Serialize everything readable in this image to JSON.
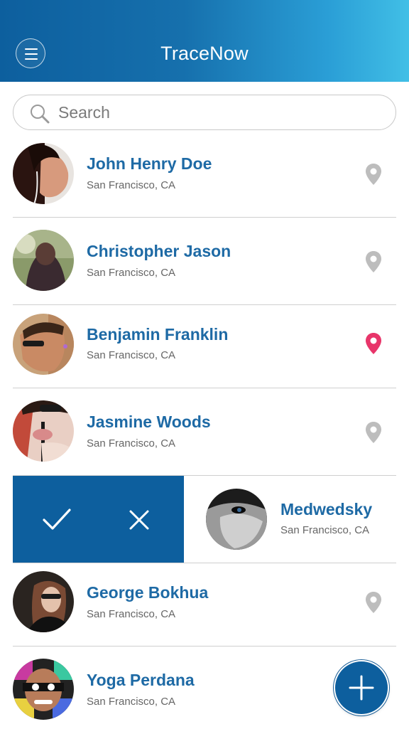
{
  "header": {
    "title": "TraceNow",
    "menu_icon": "hamburger-icon",
    "gradient_colors": [
      "#0d5f9e",
      "#41bfe6"
    ]
  },
  "search": {
    "placeholder": "Search",
    "icon": "search-icon"
  },
  "colors": {
    "accent": "#1e6aa5",
    "pin_inactive": "#bdbdbd",
    "pin_active": "#e8356a",
    "swipe_bg": "#0d5f9e"
  },
  "contacts": [
    {
      "name": "John Henry Doe",
      "location": "San Francisco, CA",
      "pin_active": false
    },
    {
      "name": "Christopher Jason",
      "location": "San Francisco, CA",
      "pin_active": false
    },
    {
      "name": "Benjamin Franklin",
      "location": "San Francisco, CA",
      "pin_active": true
    },
    {
      "name": "Jasmine Woods",
      "location": "San Francisco, CA",
      "pin_active": false
    },
    {
      "name": "Medwedsky",
      "location": "San Francisco, CA",
      "pin_active": false,
      "swiped": true
    },
    {
      "name": "George Bokhua",
      "location": "San Francisco, CA",
      "pin_active": false
    },
    {
      "name": "Yoga Perdana",
      "location": "San Francisco, CA",
      "pin_active": false
    }
  ],
  "swipe_actions": {
    "accept_icon": "checkmark-icon",
    "reject_icon": "close-icon"
  },
  "fab": {
    "icon": "plus-icon"
  }
}
